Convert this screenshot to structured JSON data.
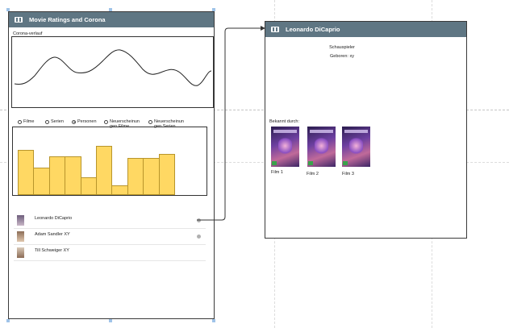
{
  "left_panel": {
    "title": "Movie Ratings and Corona",
    "chart_label": "Corona-verlauf",
    "radio_options": [
      {
        "label": "Filme",
        "selected": false
      },
      {
        "label": "Serien",
        "selected": false
      },
      {
        "label": "Personen",
        "selected": true
      },
      {
        "label": "Neuerscheinun gen Filme",
        "selected": false
      },
      {
        "label": "Neuerscheinun gen Serien",
        "selected": false
      }
    ],
    "bar_values": [
      0.7,
      0.42,
      0.6,
      0.6,
      0.27,
      0.76,
      0.15,
      0.57,
      0.57,
      0.64
    ],
    "people": [
      {
        "name": "Leonardo DiCaprio"
      },
      {
        "name": "Adam Sandler XY"
      },
      {
        "name": "Till Schweiger XY"
      }
    ]
  },
  "right_panel": {
    "title": "Leonardo DiCaprio",
    "role": "Schauspieler",
    "born": "Geboren: xy",
    "known_for_label": "Bekannt durch:",
    "films": [
      {
        "label": "Film 1"
      },
      {
        "label": "Film 2"
      },
      {
        "label": "Film 3"
      }
    ]
  },
  "colors": {
    "header": "#5f7683",
    "bar_fill": "#ffd863",
    "connector": "#333333"
  }
}
